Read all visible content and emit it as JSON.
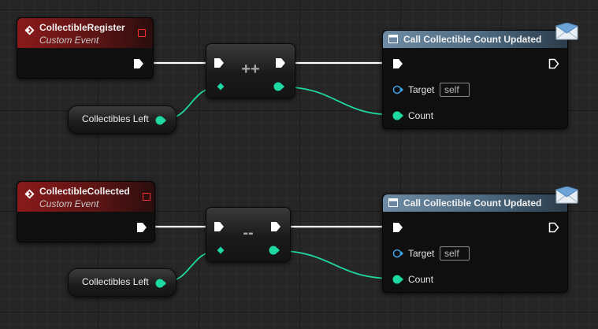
{
  "events": [
    {
      "title": "CollectibleRegister",
      "subtitle": "Custom Event"
    },
    {
      "title": "CollectibleCollected",
      "subtitle": "Custom Event"
    }
  ],
  "operators": [
    {
      "symbol": "++"
    },
    {
      "symbol": "--"
    }
  ],
  "variables": [
    {
      "label": "Collectibles Left"
    },
    {
      "label": "Collectibles Left"
    }
  ],
  "functions": [
    {
      "title": "Call Collectible Count Updated",
      "target_label": "Target",
      "target_value": "self",
      "count_label": "Count"
    },
    {
      "title": "Call Collectible Count Updated",
      "target_label": "Target",
      "target_value": "self",
      "count_label": "Count"
    }
  ],
  "colors": {
    "event_header": "#8a1a1a",
    "function_header": "#5a7a93",
    "integer_pin": "#1fd9a3",
    "exec_wire": "#ffffff",
    "target_pin": "#3fa3e6",
    "delegate_pin": "#ee3030"
  },
  "icons": [
    "event-diamond-icon",
    "function-icon",
    "message-icon"
  ]
}
